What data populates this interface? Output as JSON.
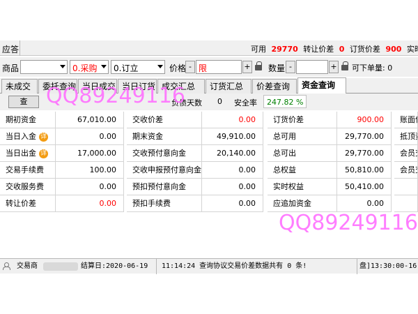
{
  "header": {
    "left_label": "应答",
    "available_label": "可用",
    "available_value": "29770",
    "transfer_label": "转让价差",
    "transfer_value": "0",
    "order_diff_label": "订货价差",
    "order_diff_value": "900",
    "realtime_label": "实时价差"
  },
  "order": {
    "product_label": "商品",
    "side_value": "0.采购",
    "type_value": "0.订立",
    "price_label": "价格",
    "minus": "-",
    "plus": "+",
    "price_value": "限",
    "qty_label": "数量",
    "max_qty_label": "可下单量: 0"
  },
  "tabs": [
    "未成交",
    "委托查询",
    "当日成交",
    "当日订货",
    "成交汇总",
    "订货汇总",
    "价差查询",
    "资金查询"
  ],
  "subbar": {
    "query_button": "查",
    "debt_days_label": "负债天数",
    "debt_days_value": "0",
    "safety_label": "安全率",
    "safety_value": "247.82 %"
  },
  "rows": [
    [
      {
        "label": "期初资金",
        "value": "67,010.00",
        "red": false,
        "badge": false
      },
      {
        "label": "交收价差",
        "value": "0.00",
        "red": true
      },
      {
        "label": "订货价差",
        "value": "900.00",
        "red": true
      },
      {
        "label": "账面保"
      }
    ],
    [
      {
        "label": "当日入金",
        "value": "0.00",
        "red": false,
        "badge": true
      },
      {
        "label": "期末资金",
        "value": "49,910.00",
        "red": false
      },
      {
        "label": "总可用",
        "value": "29,770.00",
        "red": false
      },
      {
        "label": "抵顶资"
      }
    ],
    [
      {
        "label": "当日出金",
        "value": "17,000.00",
        "red": false,
        "badge": true
      },
      {
        "label": "交收预付意向金",
        "value": "20,140.00",
        "red": false
      },
      {
        "label": "总可出",
        "value": "29,770.00",
        "red": false
      },
      {
        "label": "会员交"
      }
    ],
    [
      {
        "label": "交易手续费",
        "value": "100.00",
        "red": false,
        "badge": false
      },
      {
        "label": "交收申报预付意向金",
        "value": "0.00",
        "red": false
      },
      {
        "label": "总权益",
        "value": "50,810.00",
        "red": false
      },
      {
        "label": "会员交"
      }
    ],
    [
      {
        "label": "交收服务费",
        "value": "0.00",
        "red": false,
        "badge": false
      },
      {
        "label": "预扣预付意向金",
        "value": "0.00",
        "red": false
      },
      {
        "label": "实时权益",
        "value": "50,410.00",
        "red": false
      },
      {
        "label": ""
      }
    ],
    [
      {
        "label": "转让价差",
        "value": "0.00",
        "red": true,
        "badge": false
      },
      {
        "label": "预扣手续费",
        "value": "0.00",
        "red": false
      },
      {
        "label": "应追加资金",
        "value": "0.00",
        "red": false
      },
      {
        "label": ""
      }
    ]
  ],
  "badge_text": "详",
  "status": {
    "exchange_label": "交易商",
    "settle_label": "结算日:2020-06-19",
    "message": "11:14:24 查询协议交易价差数据共有 0 条!",
    "right_text": "盘]13:30:00-16"
  },
  "watermark": {
    "text1": "QQ89249116",
    "text2": "QQ89249116"
  },
  "colors": {
    "red": "#ff0000",
    "green": "#008000",
    "watermark": "#ff70ff",
    "badge": "#f39c12"
  }
}
